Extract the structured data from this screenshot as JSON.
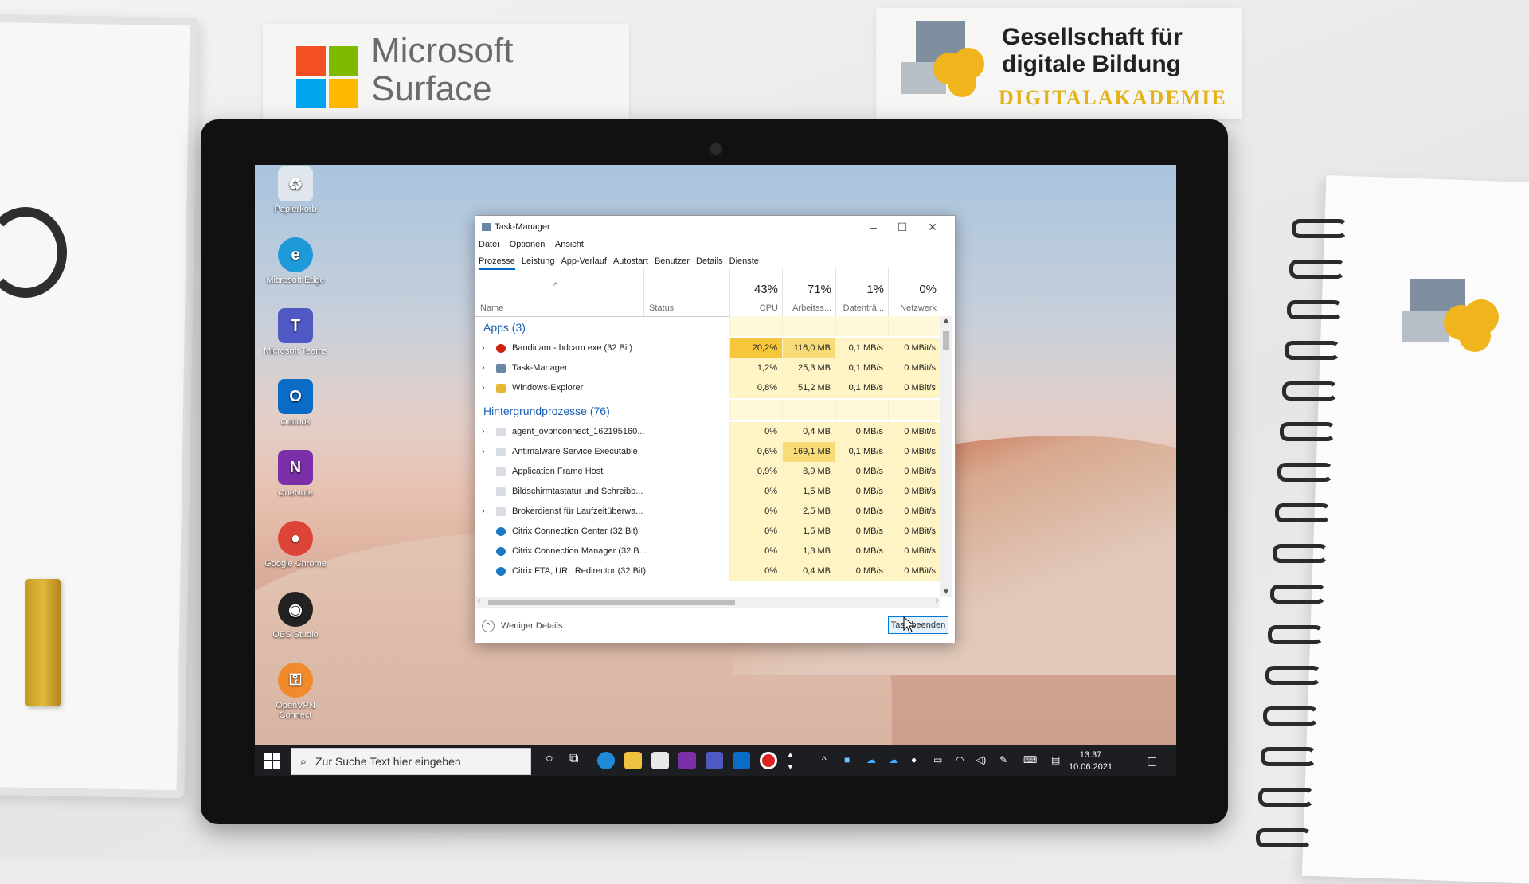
{
  "brand_left": {
    "name_line1": "Microsoft",
    "name_line2": "Surface",
    "logo_colors": [
      "#f25022",
      "#7fba00",
      "#00a4ef",
      "#ffb900"
    ]
  },
  "brand_right": {
    "line1": "Gesellschaft für",
    "line2": "digitale Bildung",
    "line3": "DIGITALAKADEMIE",
    "accent": "#e4b21b"
  },
  "desktop": {
    "icons": [
      {
        "label": "Papierkorb",
        "icon": "recycle-bin-icon"
      },
      {
        "label": "Microsoft Edge",
        "icon": "edge-icon"
      },
      {
        "label": "Microsoft Teams",
        "icon": "teams-icon"
      },
      {
        "label": "Outlook",
        "icon": "outlook-icon"
      },
      {
        "label": "OneNote",
        "icon": "onenote-icon"
      },
      {
        "label": "Google Chrome",
        "icon": "chrome-icon"
      },
      {
        "label": "OBS Studio",
        "icon": "obs-icon"
      },
      {
        "label": "OpenVPN Connect",
        "icon": "openvpn-icon"
      }
    ]
  },
  "taskmanager": {
    "title": "Task-Manager",
    "menu": [
      "Datei",
      "Optionen",
      "Ansicht"
    ],
    "tabs": [
      "Prozesse",
      "Leistung",
      "App-Verlauf",
      "Autostart",
      "Benutzer",
      "Details",
      "Dienste"
    ],
    "active_tab": "Prozesse",
    "columns": {
      "name": "Name",
      "status": "Status",
      "cpu": {
        "pct": "43%",
        "label": "CPU"
      },
      "mem": {
        "pct": "71%",
        "label": "Arbeitss..."
      },
      "disk": {
        "pct": "1%",
        "label": "Datenträ..."
      },
      "net": {
        "pct": "0%",
        "label": "Netzwerk"
      }
    },
    "groups": {
      "apps": "Apps (3)",
      "background": "Hintergrundprozesse (76)"
    },
    "apps": [
      {
        "name": "Bandicam - bdcam.exe (32 Bit)",
        "cpu": "20,2%",
        "mem": "116,0 MB",
        "disk": "0,1 MB/s",
        "net": "0 MBit/s",
        "expand": true,
        "icon": "bandicam-icon"
      },
      {
        "name": "Task-Manager",
        "cpu": "1,2%",
        "mem": "25,3 MB",
        "disk": "0,1 MB/s",
        "net": "0 MBit/s",
        "expand": true,
        "icon": "taskmanager-icon"
      },
      {
        "name": "Windows-Explorer",
        "cpu": "0,8%",
        "mem": "51,2 MB",
        "disk": "0,1 MB/s",
        "net": "0 MBit/s",
        "expand": true,
        "icon": "explorer-icon"
      }
    ],
    "background": [
      {
        "name": "agent_ovpnconnect_162195160...",
        "cpu": "0%",
        "mem": "0,4 MB",
        "disk": "0 MB/s",
        "net": "0 MBit/s",
        "expand": true
      },
      {
        "name": "Antimalware Service Executable",
        "cpu": "0,6%",
        "mem": "169,1 MB",
        "disk": "0,1 MB/s",
        "net": "0 MBit/s",
        "expand": true
      },
      {
        "name": "Application Frame Host",
        "cpu": "0,9%",
        "mem": "8,9 MB",
        "disk": "0 MB/s",
        "net": "0 MBit/s",
        "expand": false
      },
      {
        "name": "Bildschirmtastatur und Schreibb...",
        "cpu": "0%",
        "mem": "1,5 MB",
        "disk": "0 MB/s",
        "net": "0 MBit/s",
        "expand": false
      },
      {
        "name": "Brokerdienst für Laufzeitüberwa...",
        "cpu": "0%",
        "mem": "2,5 MB",
        "disk": "0 MB/s",
        "net": "0 MBit/s",
        "expand": true
      },
      {
        "name": "Citrix Connection Center (32 Bit)",
        "cpu": "0%",
        "mem": "1,5 MB",
        "disk": "0 MB/s",
        "net": "0 MBit/s",
        "expand": false
      },
      {
        "name": "Citrix Connection Manager (32 B...",
        "cpu": "0%",
        "mem": "1,3 MB",
        "disk": "0 MB/s",
        "net": "0 MBit/s",
        "expand": false
      },
      {
        "name": "Citrix FTA, URL Redirector (32 Bit)",
        "cpu": "0%",
        "mem": "0,4 MB",
        "disk": "0 MB/s",
        "net": "0 MBit/s",
        "expand": false
      }
    ],
    "footer": {
      "less_details": "Weniger Details",
      "end_task": "Task beenden"
    }
  },
  "taskbar": {
    "search_placeholder": "Zur Suche Text hier eingeben",
    "time": "13:37",
    "date": "10.06.2021"
  }
}
